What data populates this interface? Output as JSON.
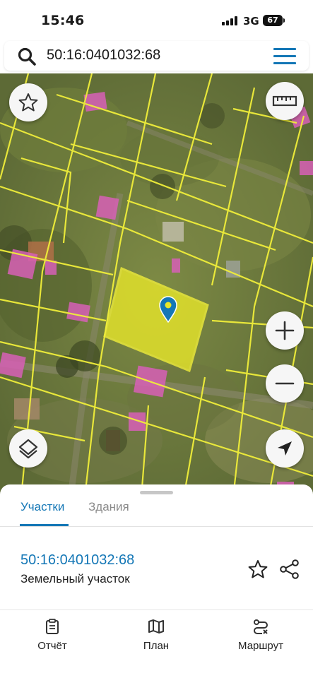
{
  "status_bar": {
    "time": "15:46",
    "network": "3G",
    "battery": "67"
  },
  "search": {
    "query": "50:16:0401032:68",
    "icon": "search-icon",
    "menu_icon": "hamburger-menu-icon"
  },
  "map_controls": {
    "favorite_icon": "star-icon",
    "ruler_icon": "ruler-icon",
    "zoom_in_icon": "plus-icon",
    "zoom_out_icon": "minus-icon",
    "layers_icon": "layers-icon",
    "locate_icon": "navigation-arrow-icon"
  },
  "colors": {
    "accent": "#1477b6",
    "parcel_fill": "#e8e62a",
    "boundary": "#f0ee3a",
    "building": "#d860b8",
    "pin": "#1477b6"
  },
  "sheet": {
    "tabs": [
      {
        "label": "Участки",
        "active": true
      },
      {
        "label": "Здания",
        "active": false
      }
    ],
    "parcel": {
      "number": "50:16:0401032:68",
      "type": "Земельный участок"
    }
  },
  "bottom_nav": {
    "items": [
      {
        "label": "Отчёт",
        "icon": "report-clipboard-icon"
      },
      {
        "label": "План",
        "icon": "map-plan-icon"
      },
      {
        "label": "Маршрут",
        "icon": "route-icon"
      }
    ]
  }
}
